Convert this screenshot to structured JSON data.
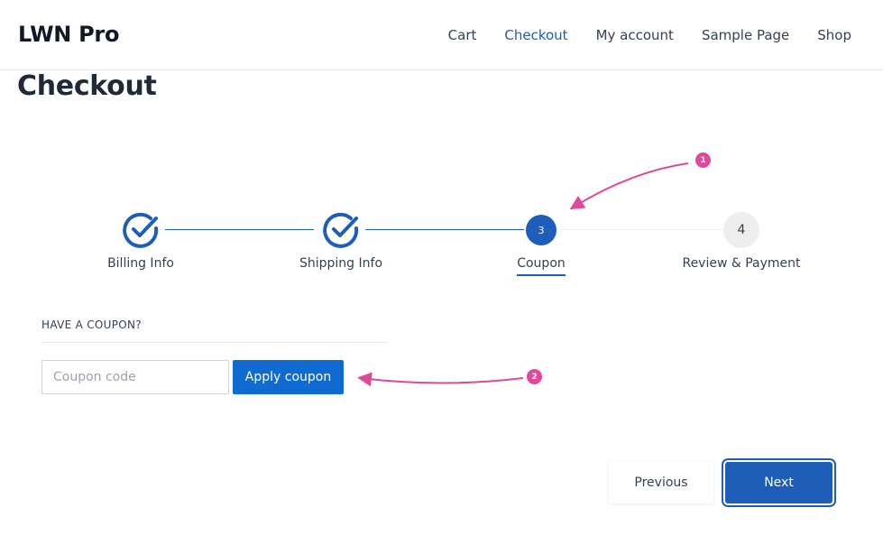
{
  "header": {
    "site_title": "LWN Pro",
    "nav": [
      {
        "label": "Cart",
        "active": false
      },
      {
        "label": "Checkout",
        "active": true
      },
      {
        "label": "My account",
        "active": false
      },
      {
        "label": "Sample Page",
        "active": false
      },
      {
        "label": "Shop",
        "active": false
      }
    ]
  },
  "page": {
    "title": "Checkout"
  },
  "steps": [
    {
      "label": "Billing Info",
      "state": "done"
    },
    {
      "label": "Shipping Info",
      "state": "done"
    },
    {
      "label": "Coupon",
      "number": "3",
      "state": "current"
    },
    {
      "label": "Review & Payment",
      "number": "4",
      "state": "todo"
    }
  ],
  "coupon": {
    "heading": "HAVE A COUPON?",
    "placeholder": "Coupon code",
    "apply_label": "Apply coupon"
  },
  "buttons": {
    "previous": "Previous",
    "next": "Next"
  },
  "annotations": {
    "badge1": "1",
    "badge2": "2"
  },
  "colors": {
    "primary": "#1e5eb8",
    "button_blue": "#0f6ad1",
    "annotation_pink": "#e0489b"
  }
}
